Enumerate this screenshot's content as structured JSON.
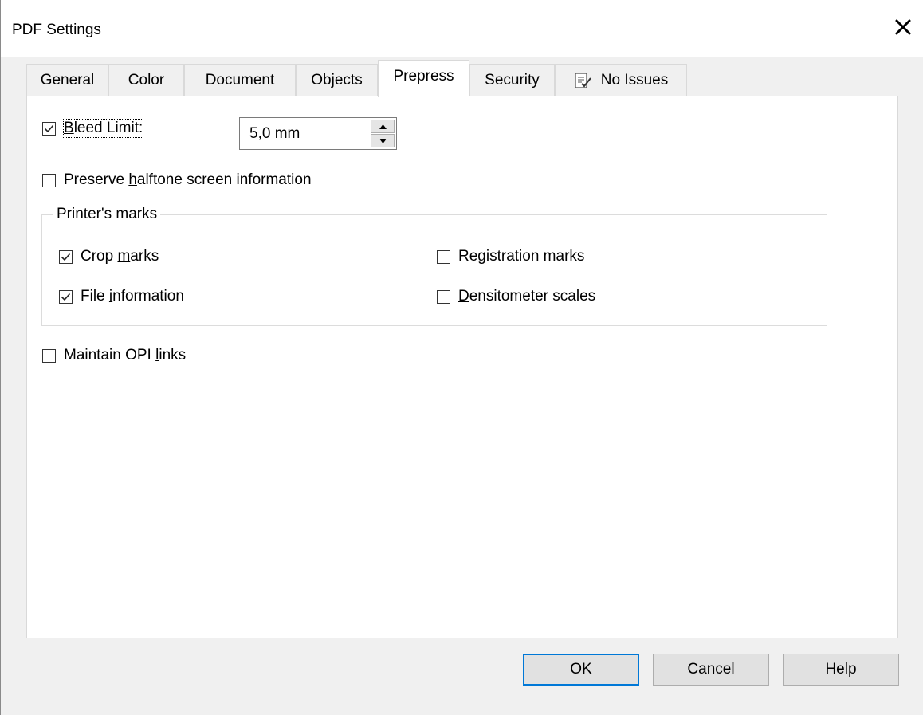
{
  "window": {
    "title": "PDF Settings",
    "close_glyph": "✕"
  },
  "tabs": [
    {
      "label": "General",
      "active": false
    },
    {
      "label": "Color",
      "active": false
    },
    {
      "label": "Document",
      "active": false
    },
    {
      "label": "Objects",
      "active": false
    },
    {
      "label": "Prepress",
      "active": true
    },
    {
      "label": "Security",
      "active": false
    },
    {
      "label": "No Issues",
      "active": false,
      "icon": "preflight-check-icon"
    }
  ],
  "prepress": {
    "bleed_limit": {
      "label_accel": "B",
      "label_rest": "leed Limit:",
      "checked": true,
      "value": "5,0 mm"
    },
    "preserve_halftone": {
      "label_pre": "Preserve ",
      "label_accel": "h",
      "label_post": "alftone screen information",
      "checked": false
    },
    "printers_marks": {
      "title": "Printer's marks",
      "crop_marks": {
        "label_pre": "Crop ",
        "label_accel": "m",
        "label_post": "arks",
        "checked": true
      },
      "file_information": {
        "label_pre": "File ",
        "label_accel": "i",
        "label_post": "nformation",
        "checked": true
      },
      "registration_marks": {
        "label_pre": "Re",
        "label_accel": "g",
        "label_post": "istration marks",
        "checked": false
      },
      "densitometer_scales": {
        "label_pre": "",
        "label_accel": "D",
        "label_post": "ensitometer scales",
        "checked": false
      }
    },
    "maintain_opi": {
      "label_pre": "Maintain OPI ",
      "label_accel": "l",
      "label_post": "inks",
      "checked": false
    }
  },
  "buttons": {
    "ok": "OK",
    "cancel": "Cancel",
    "help": "Help"
  },
  "colors": {
    "accent": "#0078d7",
    "window_bg": "#f0f0f0",
    "panel_bg": "#ffffff"
  }
}
